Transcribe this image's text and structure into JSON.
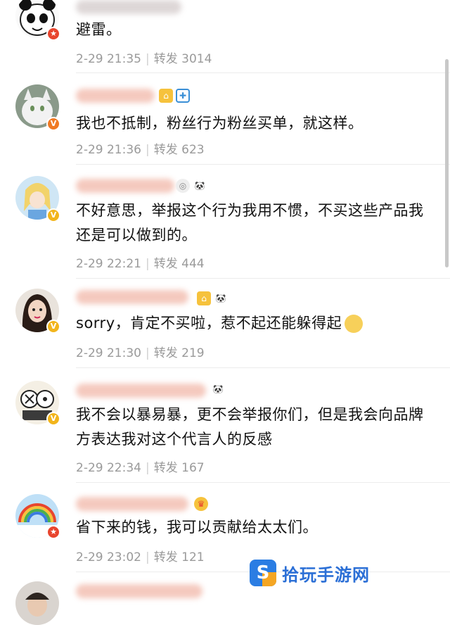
{
  "comments": [
    {
      "text": "避雷。",
      "time": "2-29 21:35",
      "repost_label": "转发",
      "repost_count": "3014"
    },
    {
      "text": "我也不抵制，粉丝行为粉丝买单，就这样。",
      "time": "2-29 21:36",
      "repost_label": "转发",
      "repost_count": "623"
    },
    {
      "text": "不好意思，举报这个行为我用不惯，不买这些产品我还是可以做到的。",
      "time": "2-29 22:21",
      "repost_label": "转发",
      "repost_count": "444"
    },
    {
      "text": "sorry，肯定不买啦，惹不起还能躲得起",
      "time": "2-29 21:30",
      "repost_label": "转发",
      "repost_count": "219"
    },
    {
      "text": "我不会以暴易暴，更不会举报你们，但是我会向品牌方表达我对这个代言人的反感",
      "time": "2-29 22:34",
      "repost_label": "转发",
      "repost_count": "167"
    },
    {
      "text": "省下来的钱，我可以贡献给太太们。",
      "time": "2-29 23:02",
      "repost_label": "转发",
      "repost_count": "121"
    }
  ],
  "watermark": {
    "text": "拾玩手游网"
  },
  "colors": {
    "meta_gray": "#9a9a9a",
    "divider": "#ececec",
    "vip_orange": "#f07a24",
    "vip_gold": "#f2b51c"
  }
}
